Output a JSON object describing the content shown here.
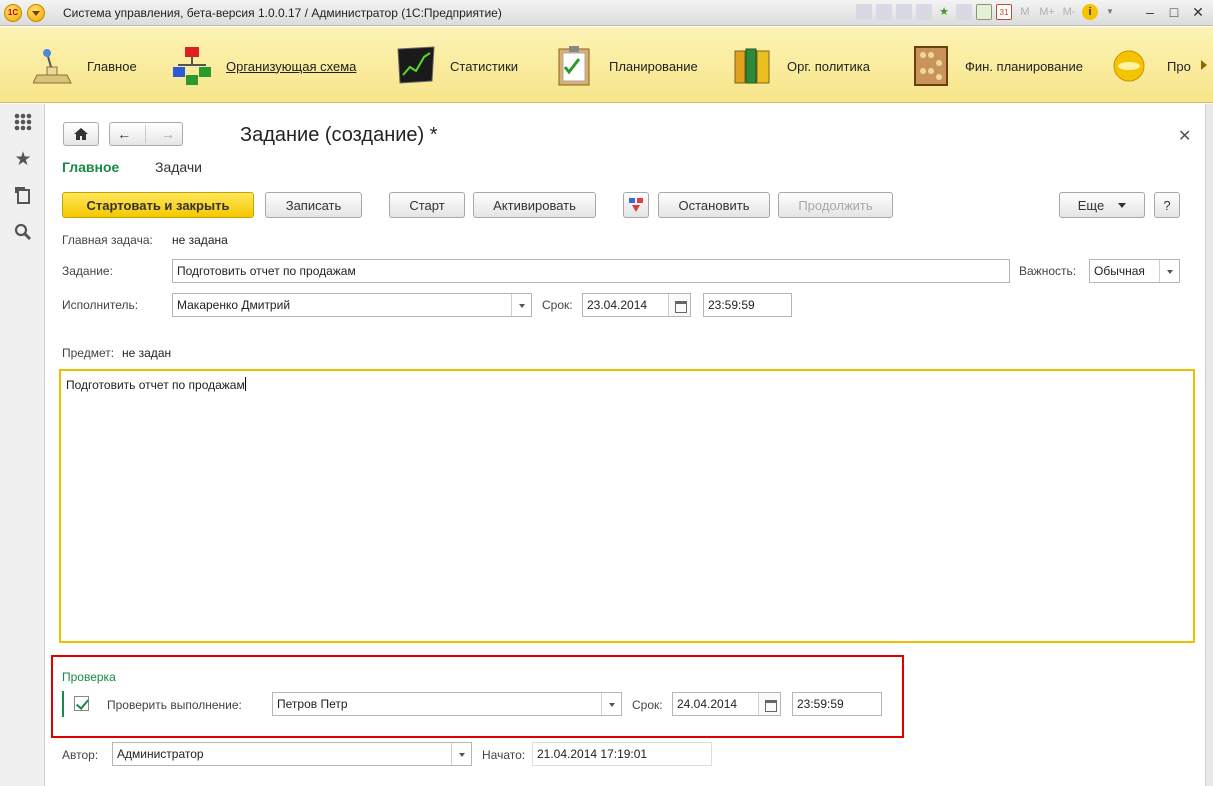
{
  "window": {
    "title": "Система управления, бета-версия 1.0.0.17 / Администратор  (1С:Предприятие)",
    "logo_text": "1С",
    "toolbar_text_icons": [
      "M",
      "M+",
      "M-"
    ],
    "controls": {
      "minimize": "–",
      "maximize": "□",
      "close": "✕"
    }
  },
  "sections": [
    {
      "label": "Главное",
      "icon": "desk-lamp-icon"
    },
    {
      "label": "Организующая схема",
      "icon": "org-chart-icon"
    },
    {
      "label": "Статистики",
      "icon": "chart-board-icon"
    },
    {
      "label": "Планирование",
      "icon": "clipboard-icon"
    },
    {
      "label": "Орг. политика",
      "icon": "binders-icon"
    },
    {
      "label": "Фин. планирование",
      "icon": "abacus-icon"
    },
    {
      "label": "Про",
      "icon": "coin-icon"
    }
  ],
  "sidebar": [
    "apps-grid-icon",
    "star-icon",
    "history-icon",
    "search-icon"
  ],
  "form": {
    "title": "Задание (создание) *",
    "tabs": [
      "Главное",
      "Задачи"
    ],
    "buttons": {
      "start_close": "Стартовать и закрыть",
      "save": "Записать",
      "start": "Старт",
      "activate": "Активировать",
      "stop": "Остановить",
      "continue": "Продолжить",
      "more": "Еще",
      "help": "?"
    },
    "main_task_label": "Главная задача:",
    "main_task_value": "не задана",
    "task_label": "Задание:",
    "task_value": "Подготовить отчет по продажам",
    "importance_label": "Важность:",
    "importance_value": "Обычная",
    "executor_label": "Исполнитель:",
    "executor_value": "Макаренко Дмитрий",
    "deadline_label": "Срок:",
    "deadline_date": "23.04.2014",
    "deadline_time": "23:59:59",
    "subject_label": "Предмет:",
    "subject_value": "не задан",
    "description": "Подготовить отчет по продажам",
    "check_group": {
      "title": "Проверка",
      "checked": true,
      "check_label": "Проверить выполнение:",
      "checker_value": "Петров Петр",
      "deadline_label": "Срок:",
      "deadline_date": "24.04.2014",
      "deadline_time": "23:59:59"
    },
    "author_label": "Автор:",
    "author_value": "Администратор",
    "started_label": "Начато:",
    "started_value": "21.04.2014 17:19:01"
  }
}
